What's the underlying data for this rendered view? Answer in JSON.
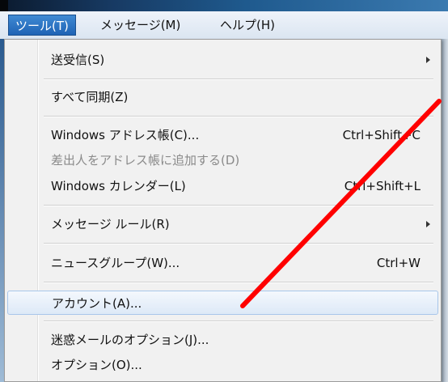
{
  "menubar": {
    "items": [
      {
        "label": "ツール(T)",
        "active": true
      },
      {
        "label": "メッセージ(M)",
        "active": false
      },
      {
        "label": "ヘルプ(H)",
        "active": false
      }
    ]
  },
  "menu": {
    "items": [
      {
        "label": "送受信(S)",
        "shortcut": "",
        "submenu": true
      },
      {
        "label": "すべて同期(Z)",
        "shortcut": ""
      },
      {
        "label": "Windows アドレス帳(C)...",
        "shortcut": "Ctrl+Shift+C"
      },
      {
        "label": "差出人をアドレス帳に追加する(D)",
        "shortcut": "",
        "disabled": true
      },
      {
        "label": "Windows カレンダー(L)",
        "shortcut": "Ctrl+Shift+L"
      },
      {
        "label": "メッセージ ルール(R)",
        "shortcut": "",
        "submenu": true
      },
      {
        "label": "ニュースグループ(W)...",
        "shortcut": "Ctrl+W"
      },
      {
        "label": "アカウント(A)...",
        "shortcut": "",
        "highlighted": true
      },
      {
        "label": "迷惑メールのオプション(J)...",
        "shortcut": ""
      },
      {
        "label": "オプション(O)...",
        "shortcut": ""
      }
    ]
  },
  "annotation": {
    "color": "#ff0000",
    "shape": "arrow-line"
  }
}
